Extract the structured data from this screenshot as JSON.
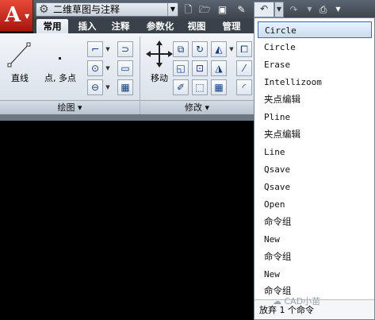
{
  "qat": {
    "workspace": "二维草图与注释",
    "icons": [
      "new-icon",
      "open-icon",
      "save-icon",
      "plot-edit-icon",
      "undo-icon",
      "redo-icon",
      "print-icon"
    ]
  },
  "tabs": [
    "常用",
    "插入",
    "注释",
    "参数化",
    "视图",
    "管理"
  ],
  "active_tab": "常用",
  "draw_panel": {
    "line_label": "直线",
    "point_label": "点, 多点",
    "title": "绘图 ▾"
  },
  "modify_panel": {
    "move_label": "移动",
    "title": "修改 ▾"
  },
  "undo_list": {
    "items": [
      "Circle",
      "Circle",
      "Erase",
      "Intellizoom",
      "夹点编辑",
      "Pline",
      "夹点编辑",
      "Line",
      "Qsave",
      "Qsave",
      "Open",
      "命令组",
      "New",
      "命令组",
      "New",
      "命令组"
    ],
    "footer": "放弃 1 个命令",
    "watermark": "CAD小苗"
  },
  "colors": {
    "ribbon": "#dfe6ee",
    "tab_bar": "#39414a",
    "highlight_border": "#3a6cb5",
    "canvas": "#000000"
  }
}
